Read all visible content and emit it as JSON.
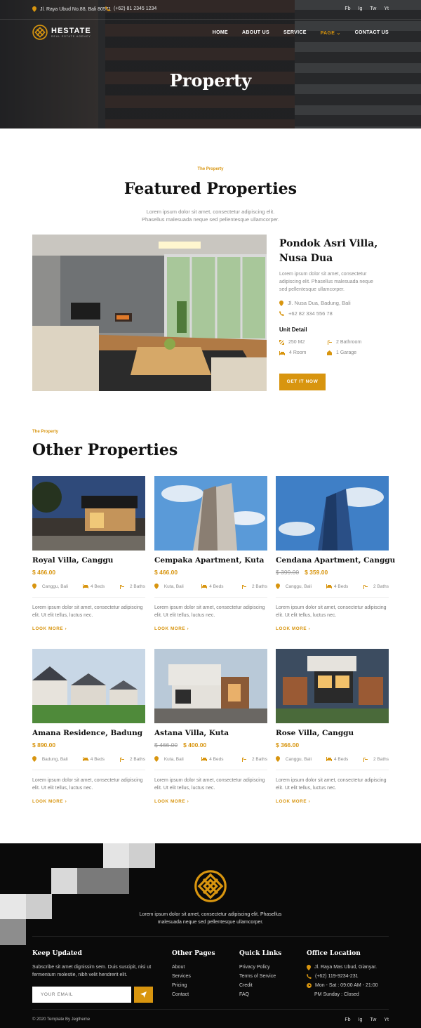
{
  "topbar": {
    "address": "Jl. Raya Ubud No.88, Bali 80571",
    "phone": "(+62) 81 2345 1234",
    "social": [
      "Fb",
      "Ig",
      "Tw",
      "Yt"
    ]
  },
  "brand": {
    "name": "HESTATE",
    "tagline": "REAL ESTATE AGENCY"
  },
  "nav": [
    {
      "label": "HOME"
    },
    {
      "label": "ABOUT US"
    },
    {
      "label": "SERVICE"
    },
    {
      "label": "PAGE",
      "active": true
    },
    {
      "label": "CONTACT US"
    }
  ],
  "hero": {
    "title": "Property"
  },
  "featured": {
    "eyebrow": "The Property",
    "title": "Featured Properties",
    "intro": "Lorem ipsum dolor sit amet, consectetur adipiscing elit. Phasellus malesuada neque sed pellentesque ullamcorper.",
    "name": "Pondok Asri Villa, Nusa Dua",
    "description": "Lorem ipsum dolor sit amet, consectetur adipiscing elit. Phasellus malesuada neque sed pellentesque ullamcorper.",
    "address": "Jl. Nusa Dua, Badung, Bali",
    "phone": "+62 82 334 556 78",
    "unit_heading": "Unit Detail",
    "units": {
      "area": "250 M2",
      "bathroom": "2 Bathroom",
      "rooms": "4 Room",
      "garage": "1 Garage"
    },
    "cta": "GET IT NOW"
  },
  "other": {
    "eyebrow": "The Property",
    "title": "Other Properties",
    "cards": [
      {
        "title": "Royal Villa, Canggu",
        "old_price": "",
        "price": "$ 466.00",
        "location": "Canggu, Bali",
        "beds": "4 Beds",
        "baths": "2 Baths",
        "desc": "Lorem ipsum dolor sit amet, consectetur adipiscing elit. Ut elit tellus, luctus nec.",
        "more": "LOOK MORE"
      },
      {
        "title": "Cempaka Apartment, Kuta",
        "old_price": "",
        "price": "$ 466.00",
        "location": "Kuta, Bali",
        "beds": "4 Beds",
        "baths": "2 Baths",
        "desc": "Lorem ipsum dolor sit amet, consectetur adipiscing elit. Ut elit tellus, luctus nec.",
        "more": "LOOK MORE"
      },
      {
        "title": "Cendana Apartment, Canggu",
        "old_price": "$ 399.00",
        "price": "$ 359.00",
        "location": "Canggu, Bali",
        "beds": "4 Beds",
        "baths": "2 Baths",
        "desc": "Lorem ipsum dolor sit amet, consectetur adipiscing elit. Ut elit tellus, luctus nec.",
        "more": "LOOK MORE"
      },
      {
        "title": "Amana Residence, Badung",
        "old_price": "",
        "price": "$ 890.00",
        "location": "Badung, Bali",
        "beds": "4 Beds",
        "baths": "2 Baths",
        "desc": "Lorem ipsum dolor sit amet, consectetur adipiscing elit. Ut elit tellus, luctus nec.",
        "more": "LOOK MORE"
      },
      {
        "title": "Astana Villa, Kuta",
        "old_price": "$ 466.00",
        "price": "$ 400.00",
        "location": "Kuta, Bali",
        "beds": "4 Beds",
        "baths": "2 Baths",
        "desc": "Lorem ipsum dolor sit amet, consectetur adipiscing elit. Ut elit tellus, luctus nec.",
        "more": "LOOK MORE"
      },
      {
        "title": "Rose Villa, Canggu",
        "old_price": "",
        "price": "$ 366.00",
        "location": "Canggu, Bali",
        "beds": "4 Beds",
        "baths": "2 Baths",
        "desc": "Lorem ipsum dolor sit amet, consectetur adipiscing elit. Ut elit tellus, luctus nec.",
        "more": "LOOK MORE"
      }
    ]
  },
  "footer": {
    "about": "Lorem ipsum dolor sit amet, consectetur adipiscing elit. Phasellus malesuada neque sed pellentesque ullamcorper.",
    "newsletter": {
      "title": "Keep Updated",
      "text": "Subscribe sit amet dignissim sem. Duis suscipit, nisi ut fermentum molestie, nibh velit hendrerit elit.",
      "placeholder": "YOUR EMAIL"
    },
    "other_pages": {
      "title": "Other Pages",
      "links": [
        "About",
        "Services",
        "Pricing",
        "Contact"
      ]
    },
    "quick_links": {
      "title": "Quick Links",
      "links": [
        "Privacy Policy",
        "Terms of Service",
        "Credit",
        "FAQ"
      ]
    },
    "office": {
      "title": "Office Location",
      "address": "Jl. Raya Mas Ubud, Gianyar.",
      "phone": "(+62) 119-9234-231",
      "hours_1": "Mon - Sat : 09:00 AM - 21:00",
      "hours_2": "PM Sunday : Closed"
    },
    "copyright": "© 2020 Template By Jegtheme",
    "social": [
      "Fb",
      "Ig",
      "Tw",
      "Yt"
    ]
  },
  "colors": {
    "accent": "#d8950f",
    "dark": "#0a0a0a",
    "heading": "#111111"
  }
}
